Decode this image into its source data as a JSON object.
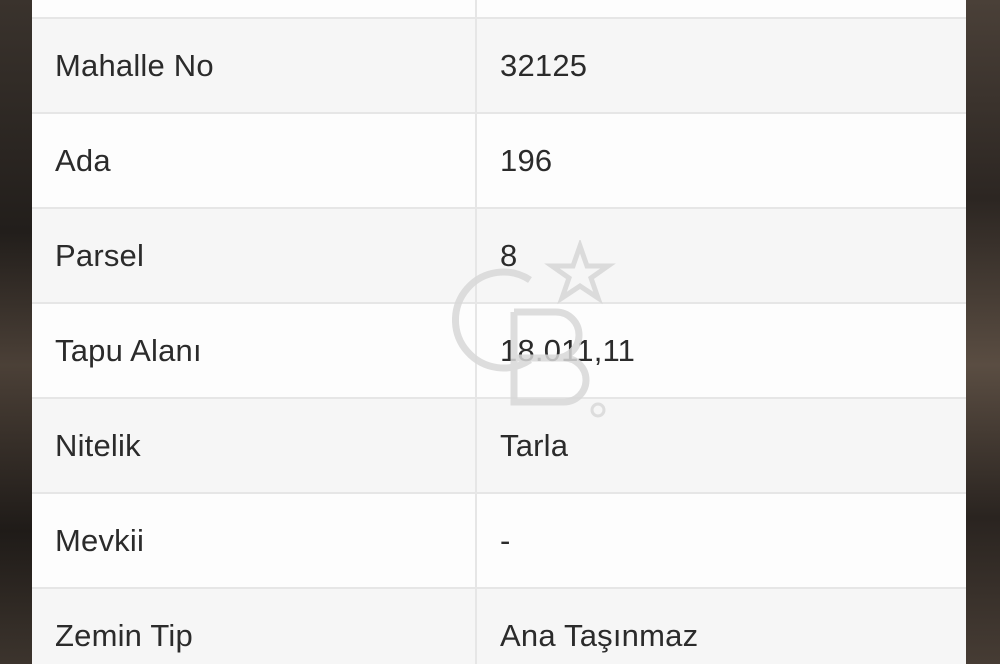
{
  "table": {
    "rows": [
      {
        "label": "",
        "value": ""
      },
      {
        "label": "Mahalle No",
        "value": "32125"
      },
      {
        "label": "Ada",
        "value": "196"
      },
      {
        "label": "Parsel",
        "value": "8"
      },
      {
        "label": "Tapu Alanı",
        "value": "18.011,11"
      },
      {
        "label": "Nitelik",
        "value": "Tarla"
      },
      {
        "label": "Mevkii",
        "value": "-"
      },
      {
        "label": "Zemin Tip",
        "value": "Ana Taşınmaz"
      }
    ]
  },
  "watermark": {
    "icon": "cb-logo-watermark-icon",
    "text": "CB"
  }
}
